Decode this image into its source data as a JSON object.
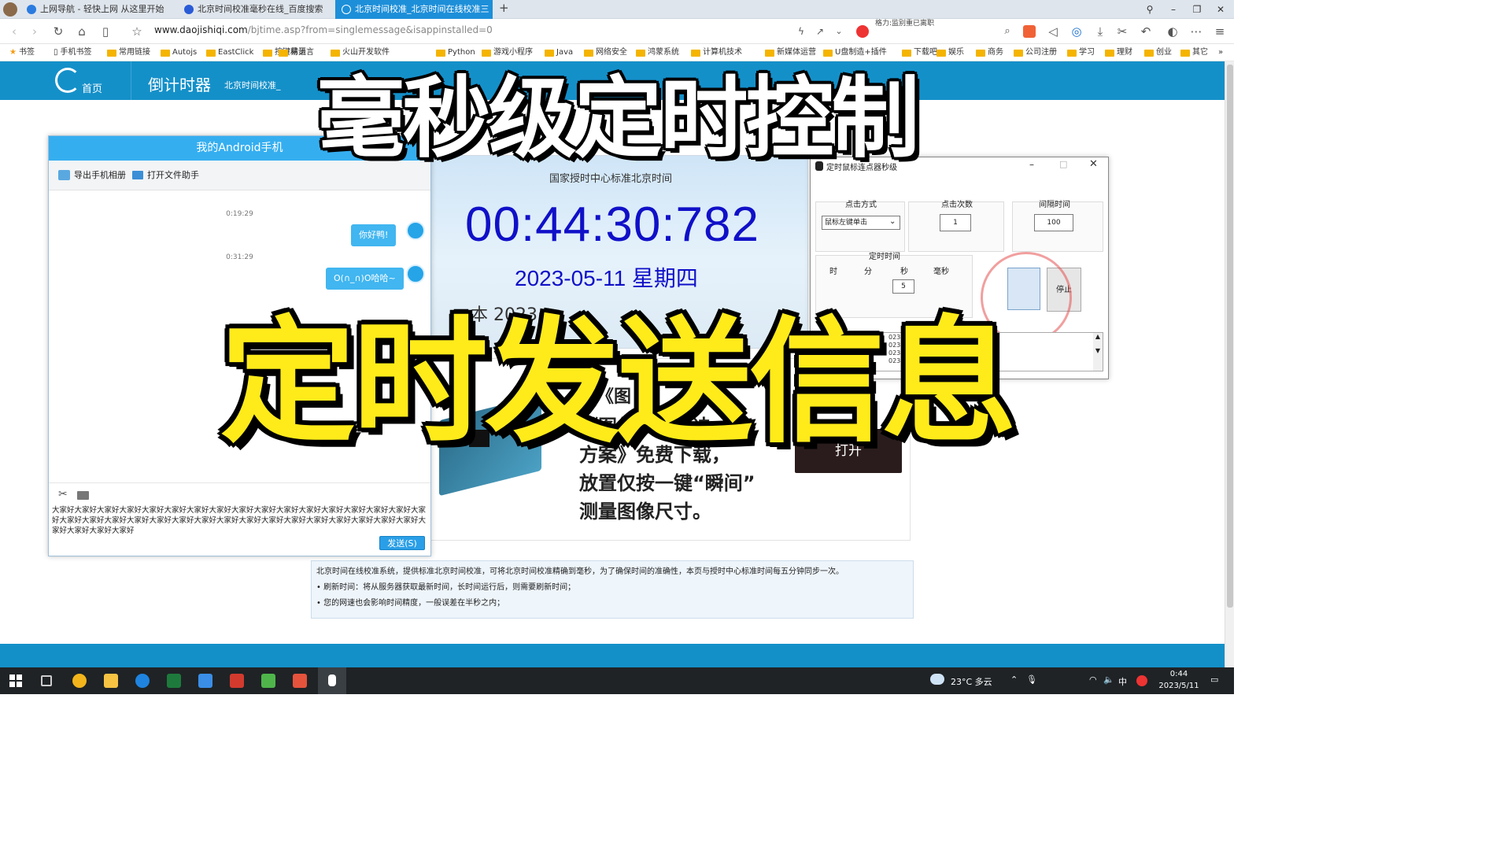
{
  "browser": {
    "tabs": [
      {
        "label": "上网导航 - 轻快上网 从这里开始",
        "active": false
      },
      {
        "label": "北京时间校准毫秒在线_百度搜索",
        "active": false
      },
      {
        "label": "北京时间校准_北京时间在线校准三",
        "active": true
      }
    ],
    "url_domain": "www.daojishiqi.com",
    "url_path": "/bjtime.asp?from=singlemessage&isappinstalled=0",
    "search_hint": "格力:监别重已离职",
    "bookmarks": [
      "书签",
      "手机书签",
      "常用链接",
      "Autojs",
      "EastClick",
      "按键精灵",
      "易语言",
      "火山开发软件",
      "Python",
      "游戏小程序",
      "Java",
      "网络安全",
      "鸿蒙系统",
      "计算机技术",
      "新媒体运营",
      "U盘制造+插件",
      "下载吧",
      "娱乐",
      "商务",
      "公司注册",
      "学习",
      "理财",
      "创业",
      "其它"
    ]
  },
  "site": {
    "home_label": "首页",
    "section_title": "倒计时器",
    "section_sub": "北京时间校准_",
    "clock_caption": "国家授时中心标准北京时间",
    "clock_time": "00:44:30:782",
    "clock_date": "2023-05-11 星期四",
    "clock_row3": "本    2023",
    "ad_heading": "《图",
    "ad_line1": "《图像尺寸解决",
    "ad_line2": "方案》免费下载，",
    "ad_line3": "放置仅按一键“瞬间”",
    "ad_line4": "测量图像尺寸。",
    "ad_button": "打开",
    "info_lines": [
      "北京时间在线校准系统，提供标准北京时间校准，可将北京时间校准精确到毫秒，为了确保时间的准确性，本页与授时中心标准时间每五分钟同步一次。",
      "• 刷新时间：将从服务器获取最新时间，长时间运行后，则需要刷新时间；",
      "• 您的网速也会影响时间精度，一般误差在半秒之内；"
    ]
  },
  "android_window": {
    "title": "我的Android手机",
    "export_label": "导出手机相册",
    "open_label": "打开文件助手",
    "messages": [
      {
        "time": "0:19:29",
        "text": "你好鸭!"
      },
      {
        "time": "0:31:29",
        "text": "O(∩_∩)O哈哈~"
      }
    ],
    "input_text": "大家好大家好大家好大家好大家好大家好大家好大家好大家好大家好大家好大家好大家好大家好大家好大家好大家好大家好大家好大家好大家好大家好大家好大家好大家好大家好大家好大家好大家好大家好大家好大家好大家好大家好大家好大家好大家好",
    "send_label": "发送(S)"
  },
  "clicker_window": {
    "title": "定时鼠标连点器秒级",
    "click_mode_label": "点击方式",
    "click_mode_value": "鼠标左键单击",
    "click_count_label": "点击次数",
    "click_count_value": "1",
    "interval_label": "间隔时间",
    "interval_value": "100",
    "timer_label": "定时时间",
    "hour_label": "时",
    "min_label": "分",
    "sec_label": "秒",
    "ms_label": "毫秒",
    "sec_value": "5",
    "stop_label": "停止",
    "log_lines": [
      "023年",
      "023年",
      "023年",
      "023年"
    ]
  },
  "overlay": {
    "headline": "毫秒级定时控制",
    "subline": "定时发送信息"
  },
  "taskbar": {
    "weather": "23°C 多云",
    "ime": "中",
    "time": "0:44",
    "date": "2023/5/11"
  },
  "colors": {
    "brand": "#1490c9",
    "clock_text": "#1010c8",
    "bubble": "#41b6f0",
    "headline_yellow": "#ffeb1a"
  }
}
